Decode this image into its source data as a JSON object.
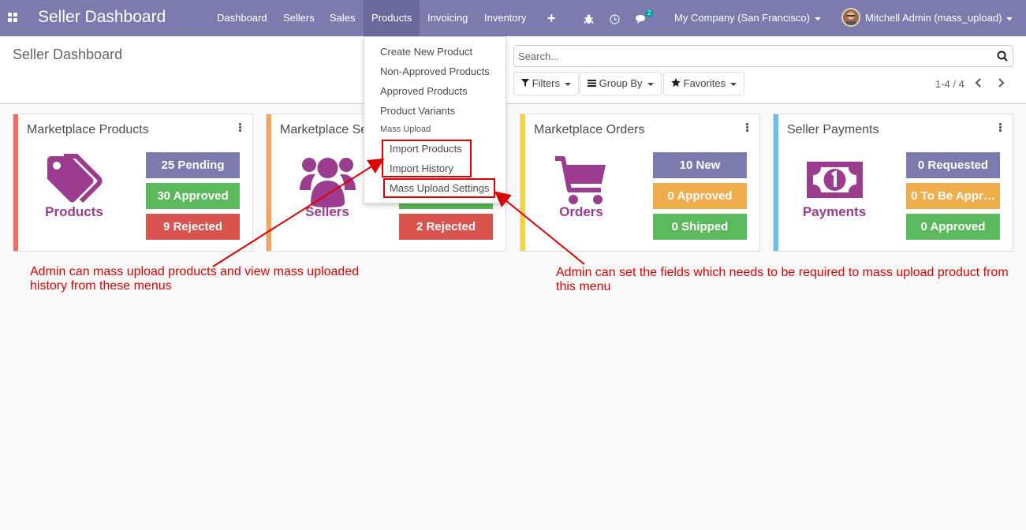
{
  "navbar": {
    "brand": "Seller Dashboard",
    "menu": [
      "Dashboard",
      "Sellers",
      "Sales",
      "Products",
      "Invoicing",
      "Inventory"
    ],
    "active_menu": "Products",
    "chat_badge": "2",
    "company": "My Company (San Francisco)",
    "user": "Mitchell Admin (mass_upload)",
    "icons": [
      "apps-icon",
      "plus-icon",
      "bug-icon",
      "clock-icon",
      "chat-icon"
    ]
  },
  "control_panel": {
    "title": "Seller Dashboard",
    "search_placeholder": "Search...",
    "filters": "Filters",
    "group_by": "Group By",
    "favorites": "Favorites",
    "pager": "1-4 / 4"
  },
  "products_menu": {
    "items": [
      "Create New Product",
      "Non-Approved Products",
      "Approved Products",
      "Product Variants"
    ],
    "section_header": "Mass Upload",
    "mass_upload_items": [
      "Import Products",
      "Import History",
      "Mass Upload Settings"
    ]
  },
  "cards": [
    {
      "title": "Marketplace Products",
      "label": "Products",
      "accent": "#ee6e60",
      "icon": "tags-icon",
      "stats": [
        {
          "text": "25 Pending",
          "color": "purple"
        },
        {
          "text": "30 Approved",
          "color": "green"
        },
        {
          "text": "9 Rejected",
          "color": "red"
        }
      ]
    },
    {
      "title": "Marketplace Sellers",
      "label": "Sellers",
      "accent": "#f4a460",
      "icon": "users-icon",
      "stats": [
        {
          "text": "",
          "color": "green"
        },
        {
          "text": "2 Rejected",
          "color": "red"
        }
      ]
    },
    {
      "title": "Marketplace Orders",
      "label": "Orders",
      "accent": "#f5d33f",
      "icon": "cart-icon",
      "stats": [
        {
          "text": "10 New",
          "color": "purple"
        },
        {
          "text": "0 Approved",
          "color": "orange"
        },
        {
          "text": "0 Shipped",
          "color": "green"
        }
      ]
    },
    {
      "title": "Seller Payments",
      "label": "Payments",
      "accent": "#69c0ef",
      "icon": "money-icon",
      "stats": [
        {
          "text": "0 Requested",
          "color": "purple"
        },
        {
          "text": "0 To Be Appr…",
          "color": "orange"
        },
        {
          "text": "0 Approved",
          "color": "green"
        }
      ]
    }
  ],
  "annotations": {
    "left": "Admin can mass upload products and view mass uploaded history from these menus",
    "right": "Admin can set the fields which needs to be required to mass upload product from this menu"
  },
  "colors": {
    "navbar": "#7c7bad",
    "brand_purple": "#9b3c8e",
    "annotation_red": "#e00000"
  }
}
